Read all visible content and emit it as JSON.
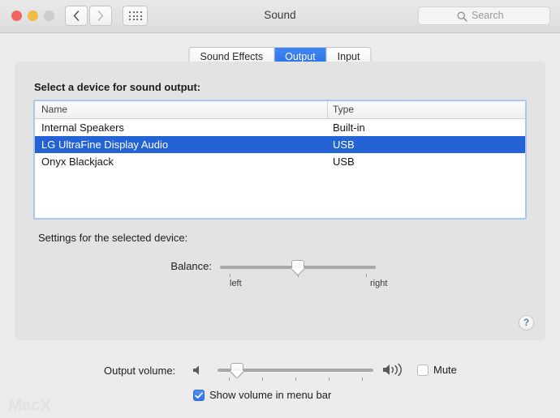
{
  "window": {
    "title": "Sound",
    "traffic_lights": [
      "close",
      "minimize",
      "zoom"
    ],
    "nav_back": "back-chevron",
    "nav_forward": "forward-chevron",
    "show_all": "grid-icon"
  },
  "search": {
    "placeholder": "Search",
    "icon": "search-icon"
  },
  "tabs": [
    {
      "label": "Sound Effects",
      "active": false
    },
    {
      "label": "Output",
      "active": true
    },
    {
      "label": "Input",
      "active": false
    }
  ],
  "panel": {
    "select_device_label": "Select a device for sound output:",
    "settings_label": "Settings for the selected device:",
    "help_label": "?"
  },
  "table": {
    "columns": [
      "Name",
      "Type"
    ],
    "rows": [
      {
        "name": "Internal Speakers",
        "type": "Built-in",
        "selected": false
      },
      {
        "name": "LG UltraFine Display Audio",
        "type": "USB",
        "selected": true
      },
      {
        "name": "Onyx Blackjack",
        "type": "USB",
        "selected": false
      }
    ]
  },
  "balance": {
    "label": "Balance:",
    "left_label": "left",
    "right_label": "right",
    "value_percent": 50
  },
  "output_volume": {
    "label": "Output volume:",
    "value_percent": 12,
    "low_icon": "speaker-low-icon",
    "high_icon": "speaker-high-icon"
  },
  "mute": {
    "label": "Mute",
    "checked": false
  },
  "show_volume_menu_bar": {
    "label": "Show volume in menu bar",
    "checked": true
  },
  "watermark": {
    "text": "MacX"
  },
  "colors": {
    "accent_blue": "#2363d6",
    "tab_active": "#2a72e8",
    "window_bg": "#ececec",
    "panel_bg": "#e3e3e3",
    "focus_ring": "#a8c8ef"
  }
}
